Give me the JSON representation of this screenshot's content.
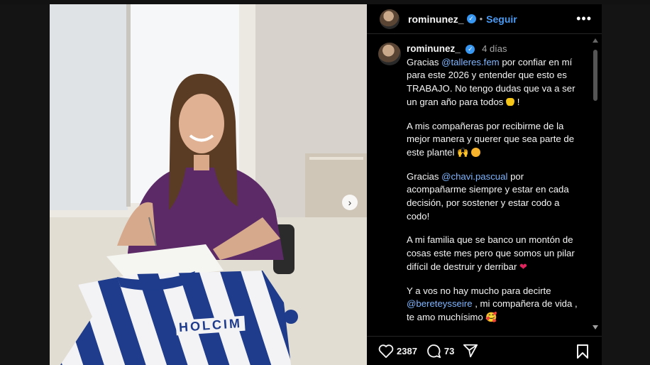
{
  "post": {
    "username": "rominunez_",
    "verified_mark": "✓",
    "separator": "•",
    "follow_label": "Seguir",
    "more_icon": "more-horizontal-icon",
    "time_ago": "4 días"
  },
  "caption": {
    "p1_a": "Gracias ",
    "p1_mention": "@talleres.fem",
    "p1_b": " por confiar en mí para este 2026 y entender que esto es TRABAJO. No tengo dudas que va a ser un gran año para todos ",
    "p1_c": " !",
    "p2": "A mis compañeras por recibirme de la mejor manera y querer que sea parte de este plantel 🙌 ",
    "p3_a": "Gracias ",
    "p3_mention": "@chavi.pascual",
    "p3_b": " por acompañarme siempre y estar en cada decisión, por sostener y estar codo a codo!",
    "p4": "A mi familia que se banco un montón de cosas este mes pero que somos un pilar difícil de destruir y derribar ",
    "p4_heart": "❤",
    "p5_a": "Y a vos no hay mucho para decirte ",
    "p5_mention": "@bereteysseire",
    "p5_b": " , mi compañera de vida , te amo muchísimo ",
    "p5_emoji": "🥰"
  },
  "actions": {
    "likes": "2387",
    "comments": "73"
  },
  "photo": {
    "jersey_text": "HOLCIM",
    "next_icon": "›"
  },
  "colors": {
    "link": "#7eb6ff",
    "follow": "#4a9cf5",
    "background": "#000000"
  }
}
